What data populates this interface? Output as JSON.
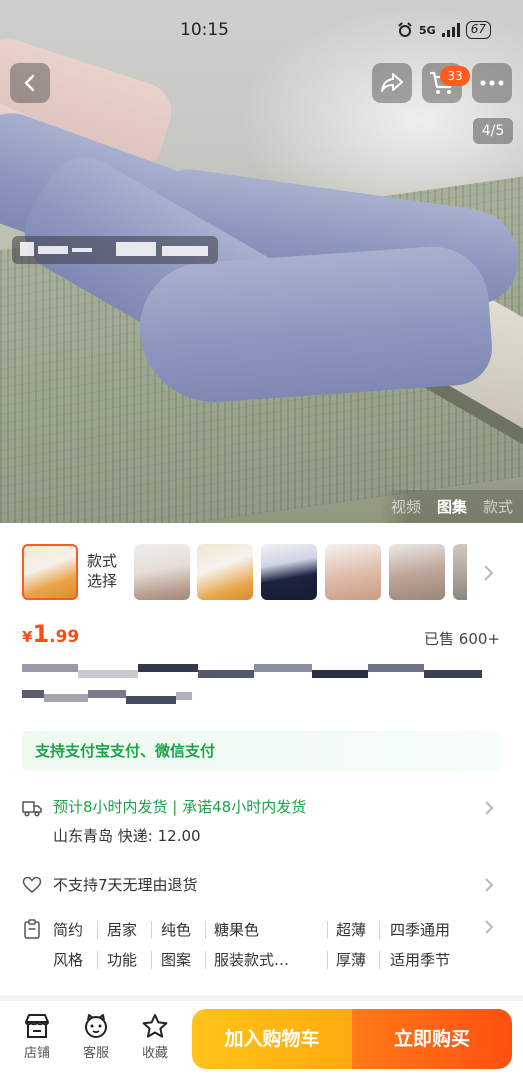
{
  "status_bar": {
    "time": "10:15",
    "network": "5G",
    "battery": "67"
  },
  "header": {
    "cart_count": "33",
    "image_pager": "4/5"
  },
  "media_tabs": [
    {
      "label": "视频",
      "active": false
    },
    {
      "label": "图集",
      "active": true
    },
    {
      "label": "款式",
      "active": false
    }
  ],
  "variants": {
    "label_line1": "款式",
    "label_line2": "选择"
  },
  "price": {
    "currency": "¥",
    "integer": "1",
    "decimal": ".99",
    "sold": "已售 600+"
  },
  "payment": {
    "text": "支持支付宝支付、微信支付"
  },
  "shipping": {
    "promise": "预计8小时内发货 | 承诺48小时内发货",
    "origin": "山东青岛",
    "express_label": "快递:",
    "express_fee": "12.00"
  },
  "returns": {
    "text": "不支持7天无理由退货"
  },
  "attributes": [
    {
      "value": "简约",
      "label": "风格"
    },
    {
      "value": "居家",
      "label": "功能"
    },
    {
      "value": "纯色",
      "label": "图案"
    },
    {
      "value": "糖果色",
      "label": "服装款式…"
    },
    {
      "value": "超薄",
      "label": "厚薄"
    },
    {
      "value": "四季通用",
      "label": "适用季节"
    }
  ],
  "bottom_bar": {
    "shop": "店铺",
    "service": "客服",
    "favorite": "收藏",
    "add_to_cart": "加入购物车",
    "buy_now": "立即购买"
  },
  "colors": {
    "accent": "#ff4a10",
    "green": "#1ea34a",
    "cta_yellow": "#ffb414",
    "cta_orange": "#ff5a14"
  }
}
